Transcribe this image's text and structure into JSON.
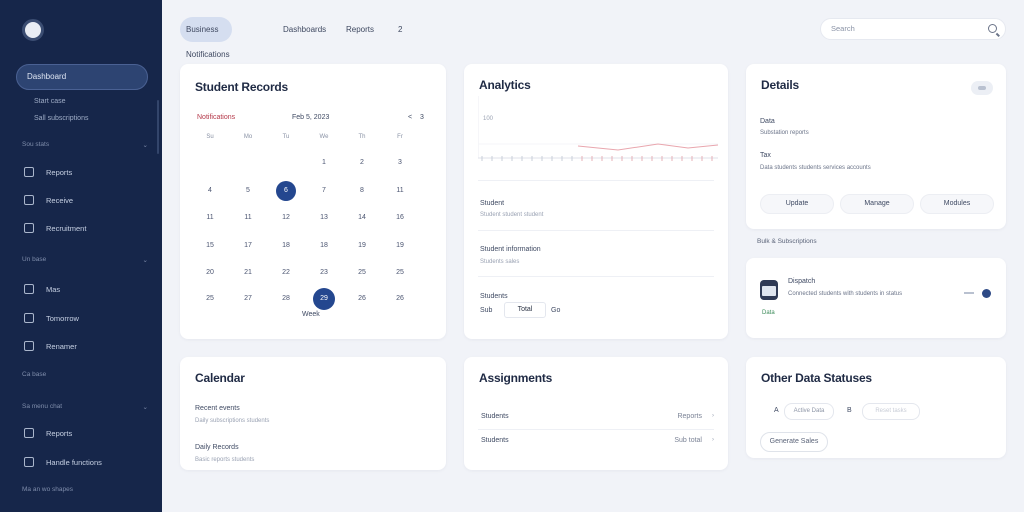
{
  "sidebar": {
    "active_item": "Dashboard",
    "sub_items": [
      "Start case",
      "Sall subscriptions"
    ],
    "sections": [
      {
        "label": "Sou stats",
        "items": [
          "Reports",
          "Receive",
          "Recruitment"
        ]
      },
      {
        "label": "Un base",
        "items": [
          "Mas",
          "Tomorrow",
          "Renamer"
        ]
      },
      {
        "label": "Ca base",
        "items": []
      },
      {
        "label": "Sa menu chat",
        "items": [
          "Reports",
          "Handle functions"
        ]
      },
      {
        "label": "Ma an wo shapes",
        "items": []
      }
    ]
  },
  "topnav": {
    "tabs": [
      "Business Notifications",
      "Dashboards",
      "Reports",
      "2"
    ],
    "search_placeholder": "Search"
  },
  "calendar_card": {
    "title": "Student Records",
    "subtitle": "Notifications",
    "month": "Feb 5, 2023",
    "weekdays": [
      "Su",
      "Mo",
      "Tu",
      "We",
      "Th",
      "Fr",
      "Sa"
    ],
    "rows": [
      [
        "",
        "",
        "",
        "1",
        "2",
        "3"
      ],
      [
        "4",
        "5",
        "6",
        "7",
        "8",
        "11"
      ],
      [
        "11",
        "11",
        "12",
        "13",
        "14",
        "16"
      ],
      [
        "15",
        "17",
        "18",
        "18",
        "19",
        "19"
      ],
      [
        "20",
        "21",
        "22",
        "23",
        "25",
        "25"
      ],
      [
        "25",
        "27",
        "28",
        "29",
        "26",
        "26"
      ]
    ],
    "selected_day": "6",
    "today_day": "29",
    "footer": "Week",
    "nav": [
      "<",
      "3"
    ]
  },
  "analytics_card": {
    "title": "Analytics",
    "axis_label": "100",
    "items": [
      {
        "title": "Student",
        "sub": "Student student student"
      },
      {
        "title": "Student information",
        "sub": "Students sales"
      },
      {
        "title": "Students",
        "sub": ""
      }
    ],
    "footer_values": [
      "Sub",
      "Total",
      "Go"
    ]
  },
  "details_card": {
    "title": "Details",
    "rows": [
      {
        "label": "Data",
        "value": "Substation reports"
      },
      {
        "label": "Tax",
        "value": "Data students students services accounts"
      }
    ],
    "pills": [
      "Update",
      "Manage",
      "Modules"
    ]
  },
  "details_footer_label": "Bulk & Subscriptions",
  "notification_card": {
    "title": "Dispatch",
    "desc": "Connected students with students in status",
    "tag": "Data"
  },
  "calendar_bottom": {
    "title": "Calendar",
    "items": [
      {
        "title": "Recent events",
        "sub": "Daily subscriptions students"
      },
      {
        "title": "Daily Records",
        "sub": "Basic reports students"
      }
    ]
  },
  "appointments_card": {
    "title": "Assignments",
    "rows": [
      {
        "label": "Students",
        "value": "Reports"
      },
      {
        "label": "Students",
        "value": "Sub total"
      }
    ]
  },
  "settings_card": {
    "title": "Other Data Statuses",
    "chips": [
      "A",
      "Active Data",
      "B",
      "Reset tasks"
    ],
    "button": "Generate Sales"
  },
  "colors": {
    "sidebar": "#16264a",
    "accent": "#24478f",
    "background": "#f1f3f8"
  }
}
